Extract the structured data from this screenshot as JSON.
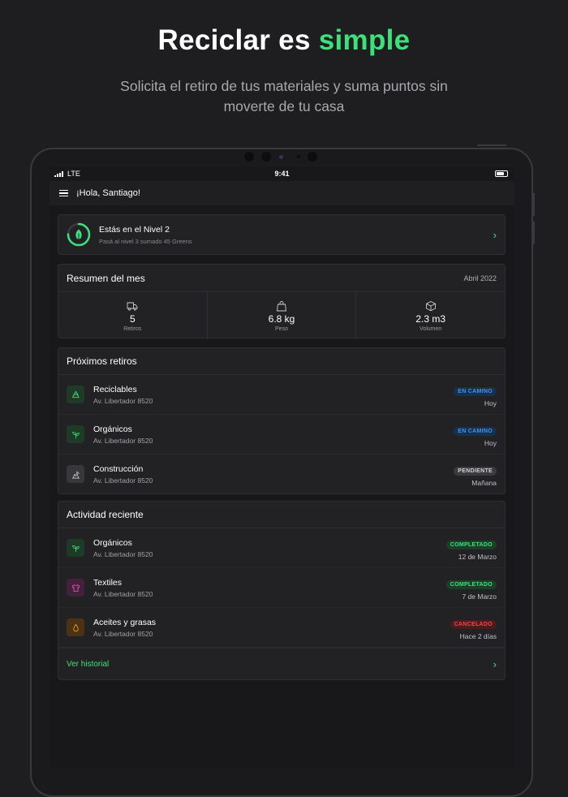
{
  "hero": {
    "title_part1": "Reciclar es",
    "title_accent": "simple",
    "subtitle": "Solicita el retiro de tus materiales y suma puntos sin moverte de tu casa"
  },
  "status_bar": {
    "carrier": "LTE",
    "time": "9:41"
  },
  "app_bar": {
    "greeting": "¡Hola, Santiago!"
  },
  "level": {
    "title": "Estás en el Nivel 2",
    "subtitle": "Pasá al nivel 3 sumado 45 Greens",
    "progress": 0.75
  },
  "summary": {
    "title": "Resumen del mes",
    "date": "Abril 2022",
    "stats": [
      {
        "icon": "truck-icon",
        "value": "5",
        "label": "Retiros"
      },
      {
        "icon": "bag-icon",
        "value": "6.8 kg",
        "label": "Peso"
      },
      {
        "icon": "box-icon",
        "value": "2.3 m3",
        "label": "Volumen"
      }
    ]
  },
  "upcoming": {
    "title": "Próximos retiros",
    "items": [
      {
        "icon": "recycle-icon",
        "title": "Reciclables",
        "address": "Av. Libertador 8520",
        "status": "EN CAMINO",
        "when": "Hoy"
      },
      {
        "icon": "sprout-icon",
        "title": "Orgánicos",
        "address": "Av. Libertador 8520",
        "status": "EN CAMINO",
        "when": "Hoy"
      },
      {
        "icon": "construction-icon",
        "title": "Construcción",
        "address": "Av. Libertador 8520",
        "status": "PENDIENTE",
        "when": "Mañana"
      }
    ]
  },
  "activity": {
    "title": "Actividad reciente",
    "items": [
      {
        "icon": "sprout-icon",
        "title": "Orgánicos",
        "address": "Av. Libertador 8520",
        "status": "COMPLETADO",
        "when": "12 de Marzo"
      },
      {
        "icon": "shirt-icon",
        "title": "Textiles",
        "address": "Av. Libertador 8520",
        "status": "COMPLETADO",
        "when": "7 de Marzo"
      },
      {
        "icon": "drop-icon",
        "title": "Aceites y grasas",
        "address": "Av. Libertador 8520",
        "status": "CANCELADO",
        "when": "Hace 2 días"
      }
    ],
    "history_link": "Ver historial"
  },
  "colors": {
    "accent": "#3ee07a",
    "background": "#1e1e20",
    "badge_en_camino": "#2f86e0",
    "badge_pendiente": "#c9c9cc",
    "badge_completado": "#3ee07a",
    "badge_cancelado": "#e2403f"
  }
}
